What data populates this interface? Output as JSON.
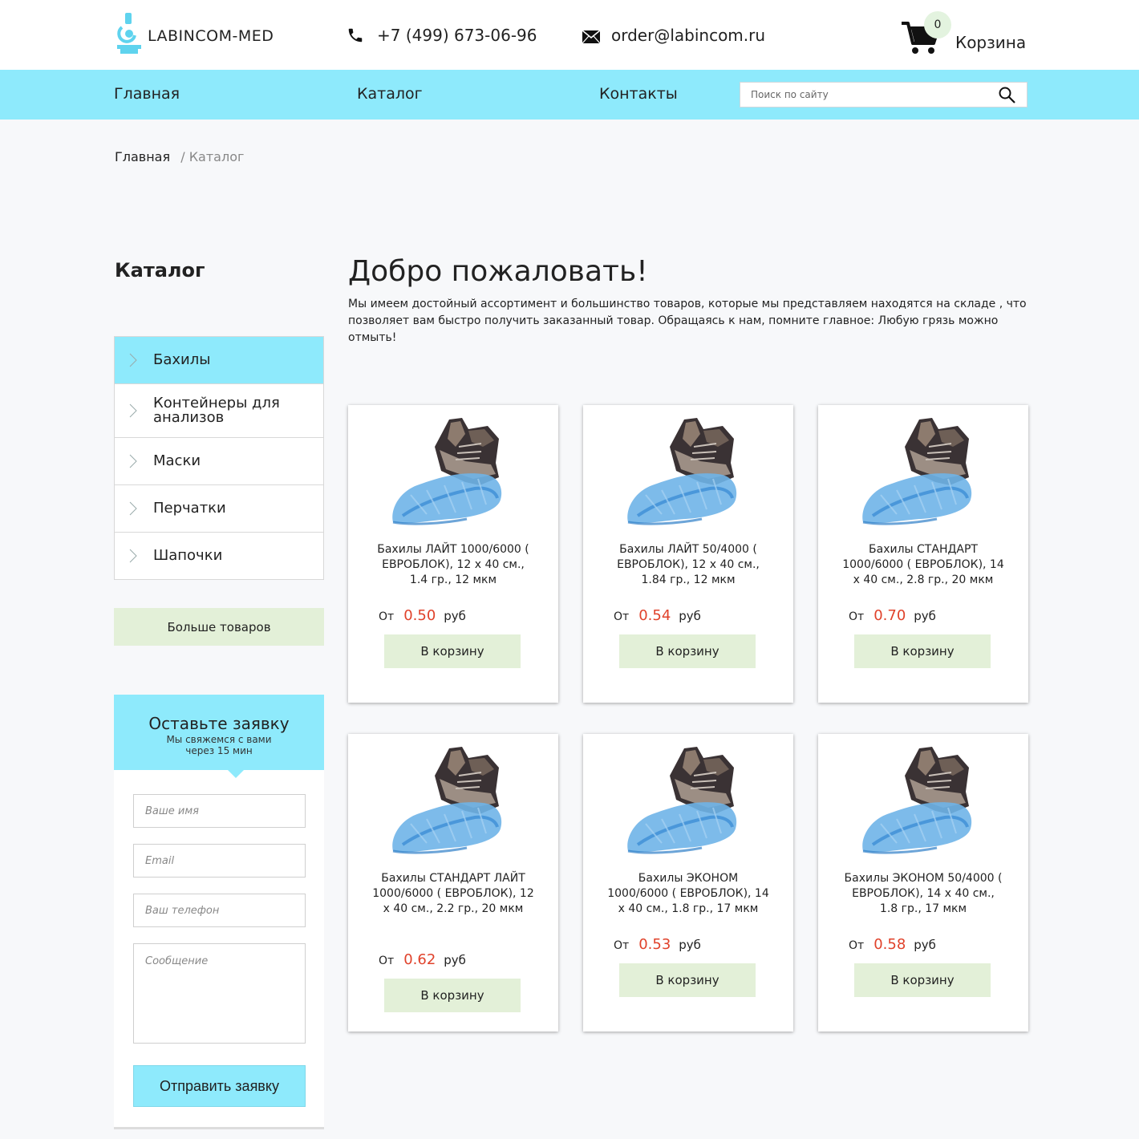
{
  "header": {
    "logo_text": "LABINCOM-MED",
    "phone": "+7 (499) 673-06-96",
    "email": "order@labincom.ru",
    "cart_count": "0",
    "cart_label": "Корзина"
  },
  "nav": {
    "items": [
      {
        "label": "Главная"
      },
      {
        "label": "Каталог"
      },
      {
        "label": "Контакты"
      }
    ],
    "search_placeholder": "Поиск по сайту"
  },
  "breadcrumb": {
    "home": "Главная",
    "separator": "/",
    "current": "Каталог"
  },
  "sidebar": {
    "title": "Каталог",
    "items": [
      {
        "label": "Бахилы",
        "active": true
      },
      {
        "label": "Контейнеры для анализов",
        "active": false
      },
      {
        "label": "Маски",
        "active": false
      },
      {
        "label": "Перчатки",
        "active": false
      },
      {
        "label": "Шапочки",
        "active": false
      }
    ],
    "more_label": "Больше товаров"
  },
  "request_form": {
    "title": "Оставьте заявку",
    "subtitle_line1": "Мы свяжемся с вами",
    "subtitle_line2": "через 15 мин",
    "name_placeholder": "Ваше имя",
    "email_placeholder": "Email",
    "phone_placeholder": "Ваш телефон",
    "message_placeholder": "Сообщение",
    "submit_label": "Отправить заявку"
  },
  "welcome": {
    "title": "Добро пожаловать!",
    "text": "Мы имеем достойный ассортимент и большинство товаров, которые мы представляем находятся на складе , что позволяет вам быстро получить заказанный товар. Обращаясь к нам, помните главное: Любую грязь можно отмыть!"
  },
  "products": [
    {
      "name": "Бахилы ЛАЙТ 1000/6000 ( ЕВРОБЛОК), 12 х 40 см., 1.4 гр., 12 мкм",
      "price_prefix": "От",
      "price": "0.50",
      "currency": "руб",
      "button": "В корзину"
    },
    {
      "name": "Бахилы ЛАЙТ 50/4000 ( ЕВРОБЛОК), 12 х 40 см., 1.84 гр., 12 мкм",
      "price_prefix": "От",
      "price": "0.54",
      "currency": "руб",
      "button": "В корзину"
    },
    {
      "name": "Бахилы СТАНДАРТ 1000/6000 ( ЕВРОБЛОК), 14 х 40 см., 2.8 гр., 20 мкм",
      "price_prefix": "От",
      "price": "0.70",
      "currency": "руб",
      "button": "В корзину"
    },
    {
      "name": "Бахилы СТАНДАРТ ЛАЙТ 1000/6000 ( ЕВРОБЛОК), 12 х 40 см., 2.2 гр., 20 мкм",
      "price_prefix": "От",
      "price": "0.62",
      "currency": "руб",
      "button": "В корзину"
    },
    {
      "name": "Бахилы ЭКОНОМ 1000/6000 ( ЕВРОБЛОК), 14 х 40 см., 1.8 гр., 17 мкм",
      "price_prefix": "От",
      "price": "0.53",
      "currency": "руб",
      "button": "В корзину"
    },
    {
      "name": "Бахилы ЭКОНОМ 50/4000 ( ЕВРОБЛОК), 14 х 40 см., 1.8 гр., 17 мкм",
      "price_prefix": "От",
      "price": "0.58",
      "currency": "руб",
      "button": "В корзину"
    }
  ],
  "colors": {
    "accent": "#8eeafc",
    "button_green": "#e3f0d8",
    "price_red": "#e0422b"
  }
}
